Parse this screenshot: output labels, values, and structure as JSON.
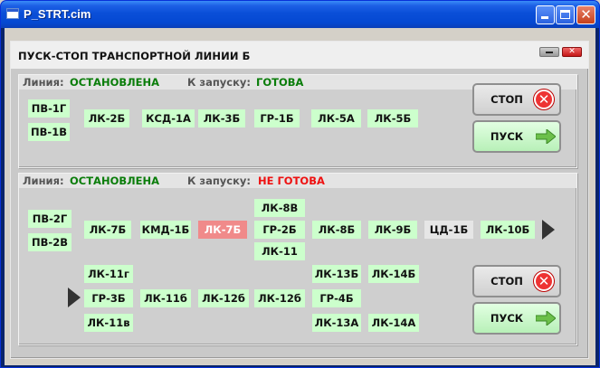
{
  "window": {
    "title": "P_STRT.cim"
  },
  "panel": {
    "title": "ПУСК-СТОП ТРАНСПОРТНОЙ ЛИНИИ Б"
  },
  "section1": {
    "line_label": "Линия:",
    "line_state": "ОСТАНОВЛЕНА",
    "ready_label": "К запуску:",
    "ready_state": "ГОТОВА",
    "units": [
      "ПВ-1Г",
      "ПВ-1В",
      "ЛК-2Б",
      "КСД-1А",
      "ЛК-3Б",
      "ГР-1Б",
      "ЛК-5А",
      "ЛК-5Б"
    ],
    "stop_label": "СТОП",
    "start_label": "ПУСК"
  },
  "section2": {
    "line_label": "Линия:",
    "line_state": "ОСТАНОВЛЕНА",
    "ready_label": "К запуску:",
    "ready_state": "НЕ ГОТОВА",
    "units": [
      "ПВ-2Г",
      "ПВ-2В",
      "ЛК-7Б",
      "КМД-1Б",
      "ЛК-7Б",
      "ЛК-8В",
      "ГР-2Б",
      "ЛК-11",
      "ЛК-8Б",
      "ЛК-9Б",
      "ЦД-1Б",
      "ЛК-10Б",
      "ЛК-11г",
      "ГР-3Б",
      "ЛК-11в",
      "ЛК-11б",
      "ЛК-12б",
      "ЛК-12б",
      "ЛК-13Б",
      "ГР-4Б",
      "ЛК-13А",
      "ЛК-14Б",
      "ЛК-14А"
    ],
    "stop_label": "СТОП",
    "start_label": "ПУСК"
  },
  "colors": {
    "ok": "#0a7d0a",
    "not_ready": "#ee1111",
    "unit_ok": "#ccffcc",
    "unit_alarm": "#f08a8a"
  }
}
